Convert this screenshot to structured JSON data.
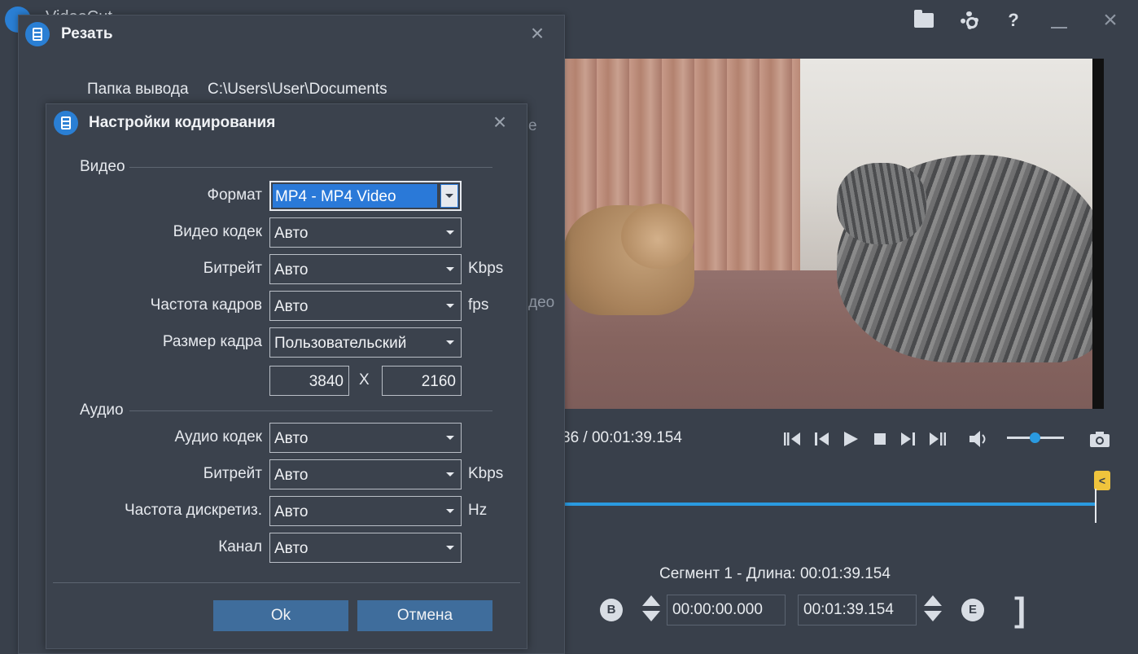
{
  "app": {
    "title": "VideoCut"
  },
  "playback": {
    "time_readout": "36 / 00:01:39.154"
  },
  "timeline": {
    "marker_label": "<"
  },
  "segment": {
    "label": "Сегмент 1 - Длина: 00:01:39.154",
    "begin_button": "B",
    "end_button": "E",
    "start_time": "00:00:00.000",
    "end_time": "00:01:39.154",
    "end_bracket": "]"
  },
  "cut_dialog": {
    "title": "Резать",
    "output_folder_label": "Папка вывода",
    "output_folder_value": "C:\\Users\\User\\Documents",
    "partial_text_1": "e",
    "partial_text_2": "део"
  },
  "encoding_dialog": {
    "title": "Настройки кодирования",
    "video_section": "Видео",
    "audio_section": "Аудио",
    "format_label": "Формат",
    "format_value": "MP4 - MP4 Video",
    "video_codec_label": "Видео кодек",
    "video_codec_value": "Авто",
    "video_bitrate_label": "Битрейт",
    "video_bitrate_value": "Авто",
    "video_bitrate_unit": "Kbps",
    "frame_rate_label": "Частота кадров",
    "frame_rate_value": "Авто",
    "frame_rate_unit": "fps",
    "frame_size_label": "Размер кадра",
    "frame_size_value": "Пользовательский",
    "width_value": "3840",
    "times_sign": "X",
    "height_value": "2160",
    "audio_codec_label": "Аудио кодек",
    "audio_codec_value": "Авто",
    "audio_bitrate_label": "Битрейт",
    "audio_bitrate_value": "Авто",
    "audio_bitrate_unit": "Kbps",
    "sample_rate_label": "Частота дискретиз.",
    "sample_rate_value": "Авто",
    "sample_rate_unit": "Hz",
    "channel_label": "Канал",
    "channel_value": "Авто",
    "ok_label": "Ok",
    "cancel_label": "Отмена"
  },
  "colors": {
    "background": "#39404b",
    "accent": "#2a9ae0",
    "button": "#3f6d9c",
    "selection": "#2a79d8",
    "marker": "#f0c43c"
  }
}
